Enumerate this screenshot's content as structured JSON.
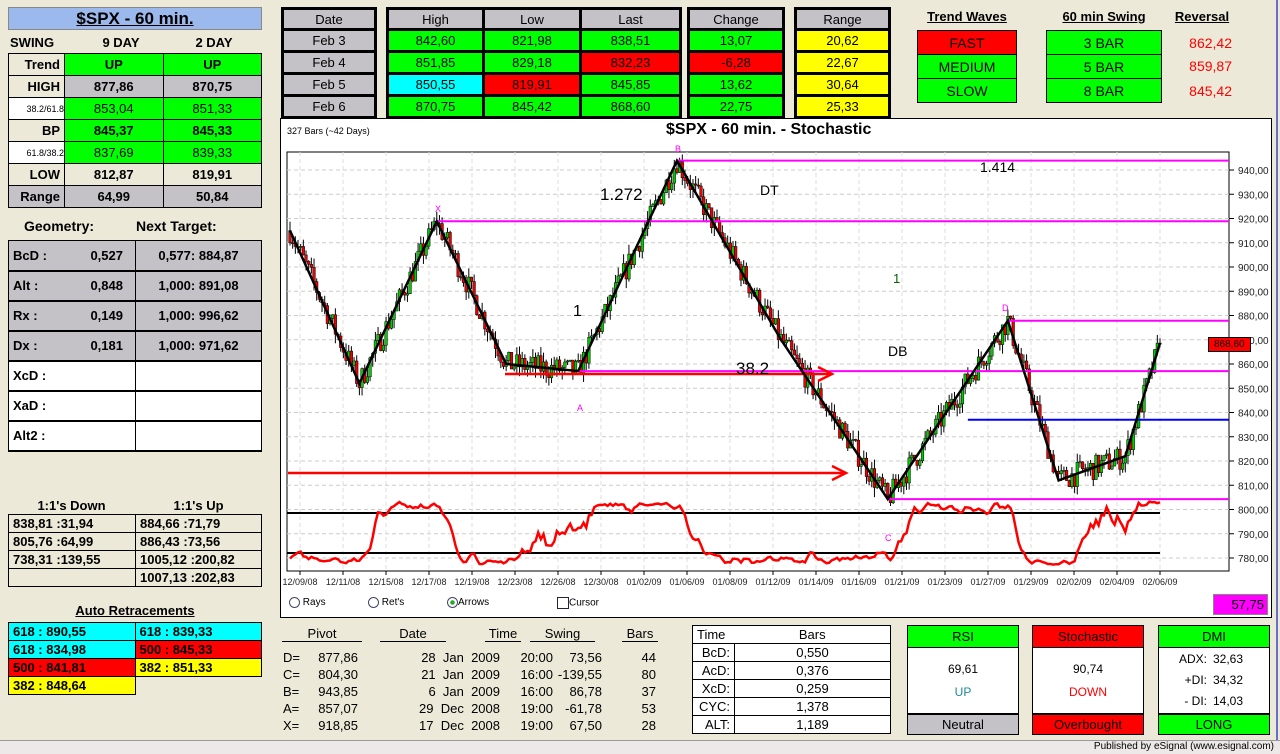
{
  "title": "$SPX - 60 min.",
  "swing": {
    "header": [
      "SWING",
      "9 DAY",
      "2 DAY"
    ],
    "rows": [
      {
        "label": "Trend",
        "a": "UP",
        "b": "UP"
      },
      {
        "label": "HIGH",
        "a": "877,86",
        "b": "870,75"
      },
      {
        "label": "38.2/61.8",
        "a": "853,04",
        "b": "851,33"
      },
      {
        "label": "BP",
        "a": "845,37",
        "b": "845,33"
      },
      {
        "label": "61.8/38.2",
        "a": "837,69",
        "b": "839,33"
      },
      {
        "label": "LOW",
        "a": "812,87",
        "b": "819,91"
      },
      {
        "label": "Range",
        "a": "64,99",
        "b": "50,84"
      }
    ]
  },
  "geometry": {
    "title": "Geometry:",
    "target_title": "Next Target:",
    "rows": [
      {
        "label": "BcD   :",
        "value": "0,527",
        "target": "0,577: 884,87"
      },
      {
        "label": "Alt    :",
        "value": "0,848",
        "target": "1,000: 891,08"
      },
      {
        "label": "Rx     :",
        "value": "0,149",
        "target": "1,000: 996,62"
      },
      {
        "label": "Dx     :",
        "value": "0,181",
        "target": "1,000: 971,62"
      },
      {
        "label": "XcD  :",
        "value": "",
        "target": ""
      },
      {
        "label": "XaD  :",
        "value": "",
        "target": ""
      },
      {
        "label": "Alt2  :",
        "value": "",
        "target": ""
      }
    ]
  },
  "ones": {
    "down_title": "1:1's Down",
    "up_title": "1:1's Up",
    "down": [
      "838,81 :31,94",
      "805,76 :64,99",
      "738,31 :139,55",
      ""
    ],
    "up": [
      "884,66 :71,79",
      "886,43 :73,56",
      "1005,12 :200,82",
      "1007,13 :202,83"
    ]
  },
  "retr": {
    "title": "Auto Retracements",
    "left": [
      "618 : 890,55",
      "618 : 834,98",
      "500 : 841,81",
      "382 : 848,64"
    ],
    "right": [
      "618 : 839,33",
      "500 : 845,33",
      "382 : 851,33",
      ""
    ]
  },
  "daily": {
    "headers": [
      "Date",
      "High",
      "Low",
      "Last",
      "Change",
      "Range"
    ],
    "rows": [
      [
        "Feb  3",
        "842,60",
        "821,98",
        "838,51",
        "13,07",
        "20,62"
      ],
      [
        "Feb  4",
        "851,85",
        "829,18",
        "832,23",
        "-6,28",
        "22,67"
      ],
      [
        "Feb  5",
        "850,55",
        "819,91",
        "845,85",
        "13,62",
        "30,64"
      ],
      [
        "Feb  6",
        "870,75",
        "845,42",
        "868,60",
        "22,75",
        "25,33"
      ]
    ]
  },
  "waves": {
    "title": "Trend Waves",
    "swing_title": "60 min Swing",
    "rev_title": "Reversal",
    "speeds": [
      "FAST",
      "MEDIUM",
      "SLOW"
    ],
    "bars": [
      "3 BAR",
      "5 BAR",
      "8 BAR"
    ],
    "reversals": [
      "862,42",
      "859,87",
      "845,42"
    ]
  },
  "chart": {
    "bars_info": "327 Bars (~42 Days)",
    "title": "$SPX - 60 min. - Stochastic",
    "last_price": "868,60",
    "stoch_value": "57,75",
    "annotations": {
      "ext1414": "1.414",
      "ext1272": "1.272",
      "dt": "DT",
      "one_a": "1",
      "one_b": "1",
      "db": "DB",
      "r382": "38.2",
      "X": "X",
      "A": "A",
      "B": "B",
      "C": "C",
      "D": "D"
    },
    "radios": [
      "Rays",
      "Ret's",
      "Arrows"
    ],
    "cursor": "Cursor"
  },
  "chart_data": {
    "type": "candlestick",
    "title": "$SPX - 60 min. - Stochastic",
    "ylim": [
      775,
      945
    ],
    "yticks": [
      "940,00",
      "930,00",
      "920,00",
      "910,00",
      "900,00",
      "890,00",
      "880,00",
      "870,00",
      "860,00",
      "850,00",
      "840,00",
      "830,00",
      "820,00",
      "810,00",
      "800,00",
      "790,00",
      "780,00"
    ],
    "xticks": [
      "12/09/08",
      "12/11/08",
      "12/15/08",
      "12/17/08",
      "12/19/08",
      "12/23/08",
      "12/26/08",
      "12/30/08",
      "01/02/09",
      "01/06/09",
      "01/08/09",
      "01/12/09",
      "01/14/09",
      "01/16/09",
      "01/21/09",
      "01/23/09",
      "01/27/09",
      "01/29/09",
      "02/02/09",
      "02/04/09",
      "02/06/09"
    ],
    "bar_count": 327,
    "price_path": [
      [
        0,
        915
      ],
      [
        26,
        852
      ],
      [
        55,
        918.85
      ],
      [
        81,
        860
      ],
      [
        108,
        857.07
      ],
      [
        145,
        943.85
      ],
      [
        184,
        870
      ],
      [
        224,
        804.3
      ],
      [
        269,
        877.86
      ],
      [
        288,
        812
      ],
      [
        313,
        822
      ],
      [
        326,
        868.6
      ]
    ],
    "levels": [
      {
        "price": 943.85,
        "from": 145,
        "color": "#ff00ff"
      },
      {
        "price": 918.85,
        "from": 55,
        "color": "#ff00ff"
      },
      {
        "price": 877.86,
        "from": 269,
        "color": "#ff00ff"
      },
      {
        "price": 857.07,
        "from": 108,
        "color": "#ff00ff"
      },
      {
        "price": 837,
        "from": 254,
        "color": "#0000ff"
      },
      {
        "price": 804.3,
        "from": 224,
        "color": "#ff00ff"
      }
    ],
    "stoch_levels": [
      80,
      20
    ]
  },
  "pivots": {
    "headers": [
      "Pivot",
      "Date",
      "Time",
      "Swing",
      "Bars"
    ],
    "rows": [
      [
        "D=",
        "877,86",
        "28  Jan  2009",
        "20:00",
        "73,56",
        "44"
      ],
      [
        "C=",
        "804,30",
        "21  Jan  2009",
        "16:00",
        "-139,55",
        "80"
      ],
      [
        "B=",
        "943,85",
        "6  Jan  2009",
        "16:00",
        "86,78",
        "37"
      ],
      [
        "A=",
        "857,07",
        "29  Dec  2008",
        "19:00",
        "-61,78",
        "53"
      ],
      [
        "X=",
        "918,85",
        "17  Dec  2008",
        "19:00",
        "67,50",
        "28"
      ]
    ]
  },
  "timebars": {
    "headers": [
      "Time",
      "Bars"
    ],
    "rows": [
      [
        "BcD:",
        "0,550"
      ],
      [
        "AcD:",
        "0,376"
      ],
      [
        "XcD:",
        "0,259"
      ],
      [
        "CYC:",
        "1,378"
      ],
      [
        "ALT:",
        "1,189"
      ]
    ]
  },
  "rsi": {
    "title": "RSI",
    "value": "69,61",
    "dir": "UP",
    "status": "Neutral"
  },
  "stoch": {
    "title": "Stochastic",
    "value": "90,74",
    "dir": "DOWN",
    "status": "Overbought"
  },
  "dmi": {
    "title": "DMI",
    "adx_label": "ADX:",
    "adx": "32,63",
    "pdi_label": "+DI:",
    "pdi": "34,32",
    "mdi_label": "- DI:",
    "mdi": "14,03",
    "status": "LONG"
  },
  "footer": "Published by eSignal (www.esignal.com)"
}
